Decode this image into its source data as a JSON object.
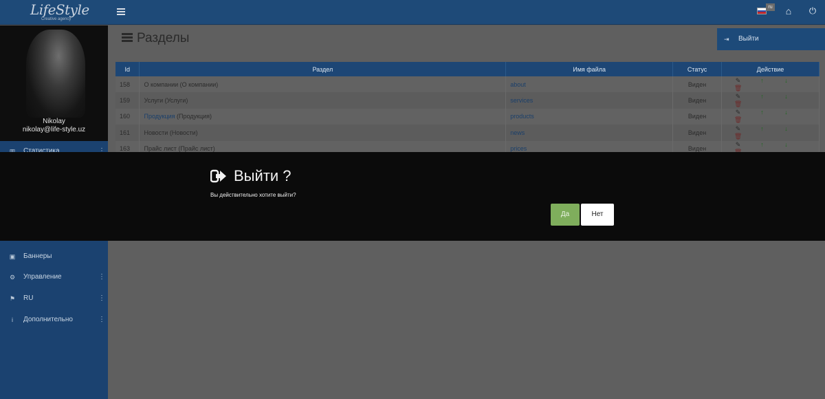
{
  "brand": {
    "logo_text": "LifeStyle",
    "tagline": "Creative agency"
  },
  "topbar": {
    "lang_badge": "ru"
  },
  "profile": {
    "name": "Nikolay",
    "email": "nikolay@life-style.uz"
  },
  "sidebar": {
    "items": [
      {
        "label": "Статистика",
        "icon": "chart-icon",
        "has_menu": true
      },
      {
        "label": "Баннеры",
        "icon": "image-icon",
        "has_menu": false
      },
      {
        "label": "Управление",
        "icon": "gears-icon",
        "has_menu": true
      },
      {
        "label": "RU",
        "icon": "flag-icon",
        "has_menu": true
      },
      {
        "label": "Дополнительно",
        "icon": "info-icon",
        "has_menu": true
      }
    ]
  },
  "page": {
    "title": "Разделы"
  },
  "exit_menu": {
    "label": "Выйти"
  },
  "table": {
    "headers": [
      "Id",
      "Раздел",
      "Имя файла",
      "Статус",
      "Действие"
    ],
    "rows": [
      {
        "id": "158",
        "name": "О компании (О компании)",
        "link_part": "",
        "file": "about",
        "status": "Виден"
      },
      {
        "id": "159",
        "name": "Услуги (Услуги)",
        "link_part": "",
        "file": "services",
        "status": "Виден"
      },
      {
        "id": "160",
        "name": " (Продукция)",
        "link_part": "Продукция",
        "file": "products",
        "status": "Виден"
      },
      {
        "id": "161",
        "name": "Новости (Новости)",
        "link_part": "",
        "file": "news",
        "status": "Виден"
      },
      {
        "id": "163",
        "name": "Прайс лист (Прайс лист)",
        "link_part": "",
        "file": "prices",
        "status": "Виден"
      }
    ]
  },
  "modal": {
    "title": "Выйти ?",
    "message": "Вы действительно хотите выйти?",
    "yes_label": "Да",
    "no_label": "Нет"
  },
  "colors": {
    "topbar": "#1e4a78",
    "sidebar": "#1b4270",
    "yes_button": "#7fae5c",
    "modal_bg": "#0b0b0b"
  }
}
